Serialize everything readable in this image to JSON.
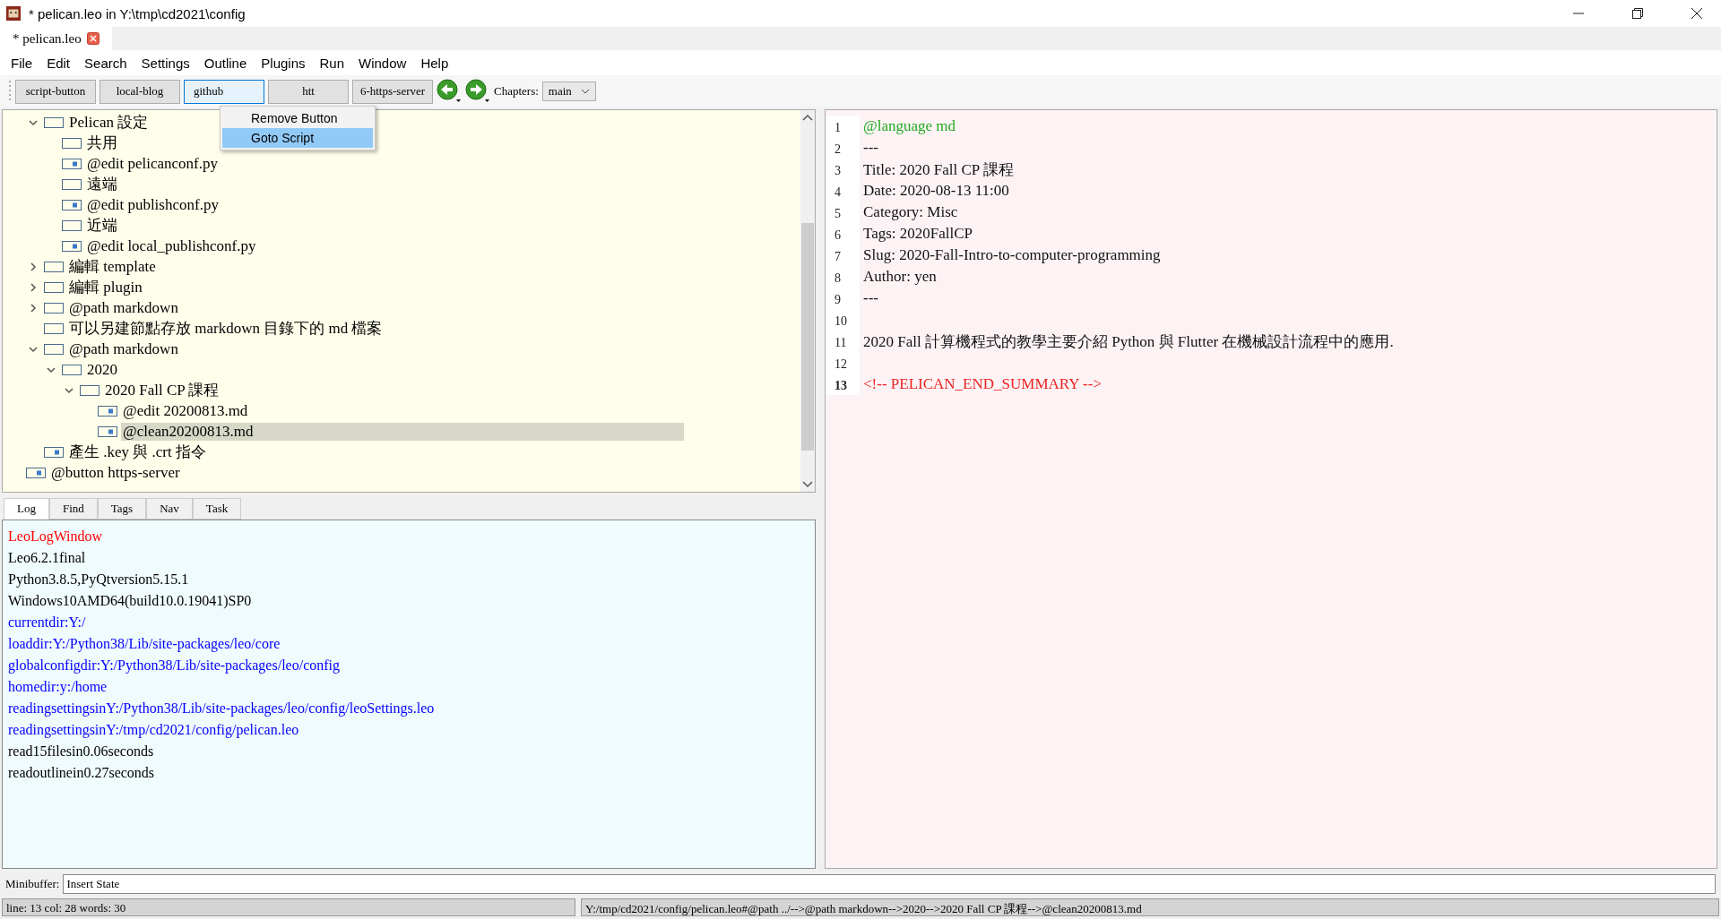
{
  "window": {
    "title": "* pelican.leo in Y:\\tmp\\cd2021\\config"
  },
  "doc_tabs": [
    {
      "label": "* pelican.leo",
      "selected": true
    }
  ],
  "menu_bar": [
    "File",
    "Edit",
    "Search",
    "Settings",
    "Outline",
    "Plugins",
    "Run",
    "Window",
    "Help"
  ],
  "toolbar": {
    "buttons": [
      {
        "label": "script-button",
        "selected": false
      },
      {
        "label": "local-blog",
        "selected": false
      },
      {
        "label": "github",
        "selected": true
      },
      {
        "label": "htt",
        "selected": false
      },
      {
        "label": "6-https-server",
        "selected": false
      }
    ],
    "chapters_label": "Chapters:",
    "chapter": "main"
  },
  "context_menu": [
    {
      "label": "Remove Button",
      "selected": false
    },
    {
      "label": "Goto Script",
      "selected": true
    }
  ],
  "tree": {
    "items": [
      {
        "label": "Pelican 設定",
        "kind": "plain",
        "expanded": true,
        "selected": false,
        "children": [
          {
            "label": "共用",
            "kind": "plain",
            "selected": false
          },
          {
            "label": "@edit pelicanconf.py",
            "kind": "file",
            "selected": false
          },
          {
            "label": "遠端",
            "kind": "plain",
            "selected": false
          },
          {
            "label": "@edit publishconf.py",
            "kind": "file",
            "selected": false
          },
          {
            "label": "近端",
            "kind": "plain",
            "selected": false
          },
          {
            "label": "@edit local_publishconf.py",
            "kind": "file",
            "selected": false
          }
        ]
      },
      {
        "label": "編輯 template",
        "kind": "plain",
        "expanded": false,
        "selected": false
      },
      {
        "label": "編輯 plugin",
        "kind": "plain",
        "expanded": false,
        "selected": false
      },
      {
        "label": "@path markdown",
        "kind": "plain",
        "expanded": false,
        "selected": false
      },
      {
        "label": "可以另建節點存放 markdown 目錄下的 md 檔案",
        "kind": "plain",
        "selected": false
      },
      {
        "label": "@path markdown",
        "kind": "plain",
        "expanded": true,
        "selected": false,
        "children": [
          {
            "label": "2020",
            "kind": "plain",
            "expanded": true,
            "selected": false,
            "children": [
              {
                "label": "2020 Fall CP 課程",
                "kind": "plain",
                "expanded": true,
                "selected": false,
                "children": [
                  {
                    "label": "@edit 20200813.md",
                    "kind": "file",
                    "selected": false
                  },
                  {
                    "label": "@clean20200813.md",
                    "kind": "file",
                    "selected": true
                  }
                ]
              }
            ]
          }
        ]
      },
      {
        "label": "產生 .key 與 .crt 指令",
        "kind": "file",
        "selected": false
      }
    ],
    "next_root": {
      "label": "@button https-server",
      "kind": "file",
      "selected": false
    }
  },
  "log_tabs": [
    {
      "label": "Log",
      "selected": true
    },
    {
      "label": "Find",
      "selected": false
    },
    {
      "label": "Tags",
      "selected": false
    },
    {
      "label": "Nav",
      "selected": false
    },
    {
      "label": "Task",
      "selected": false
    }
  ],
  "log": [
    {
      "text": "LeoLogWindow",
      "color": "#ff0000"
    },
    {
      "text": "Leo6.2.1final",
      "color": "#000000"
    },
    {
      "text": "Python3.8.5,PyQtversion5.15.1",
      "color": "#000000"
    },
    {
      "text": "Windows10AMD64(build10.0.19041)SP0",
      "color": "#000000"
    },
    {
      "text": "currentdir:Y:/",
      "color": "#0000ff"
    },
    {
      "text": "loaddir:Y:/Python38/Lib/site-packages/leo/core",
      "color": "#0000ff"
    },
    {
      "text": "globalconfigdir:Y:/Python38/Lib/site-packages/leo/config",
      "color": "#0000ff"
    },
    {
      "text": "homedir:y:/home",
      "color": "#0000ff"
    },
    {
      "text": "readingsettingsinY:/Python38/Lib/site-packages/leo/config/leoSettings.leo",
      "color": "#0000ff"
    },
    {
      "text": "readingsettingsinY:/tmp/cd2021/config/pelican.leo",
      "color": "#0000ff"
    },
    {
      "text": "read15filesin0.06seconds",
      "color": "#000000"
    },
    {
      "text": "readoutlinein0.27seconds",
      "color": "#000000"
    }
  ],
  "editor": [
    {
      "number": "1",
      "text": "@language md",
      "kind": "directive",
      "current": false
    },
    {
      "number": "2",
      "text": "---",
      "kind": "text",
      "current": false
    },
    {
      "number": "3",
      "text": "Title: 2020 Fall CP 課程",
      "kind": "text",
      "current": false
    },
    {
      "number": "4",
      "text": "Date: 2020-08-13 11:00",
      "kind": "text",
      "current": false
    },
    {
      "number": "5",
      "text": "Category: Misc",
      "kind": "text",
      "current": false
    },
    {
      "number": "6",
      "text": "Tags: 2020FallCP",
      "kind": "text",
      "current": false
    },
    {
      "number": "7",
      "text": "Slug: 2020-Fall-Intro-to-computer-programming",
      "kind": "text",
      "current": false
    },
    {
      "number": "8",
      "text": "Author: yen",
      "kind": "text",
      "current": false
    },
    {
      "number": "9",
      "text": "---",
      "kind": "text",
      "current": false
    },
    {
      "number": "10",
      "current": false
    },
    {
      "number": "11",
      "text": "2020 Fall 計算機程式的教學主要介紹 Python 與 Flutter 在機械設計流程中的應用.",
      "kind": "text",
      "current": false
    },
    {
      "number": "12",
      "current": false
    },
    {
      "number": "13",
      "text": "<!-- PELICAN_END_SUMMARY -->",
      "kind": "comment",
      "current": true
    }
  ],
  "minibuffer": {
    "label": "Minibuffer:",
    "value": "Insert State"
  },
  "status_bar": {
    "left": "line: 13 col: 28  words: 30",
    "right": "Y:/tmp/cd2021/config/pelican.leo#@path ../-->@path markdown-->2020-->2020 Fall CP 課程-->@clean20200813.md"
  }
}
